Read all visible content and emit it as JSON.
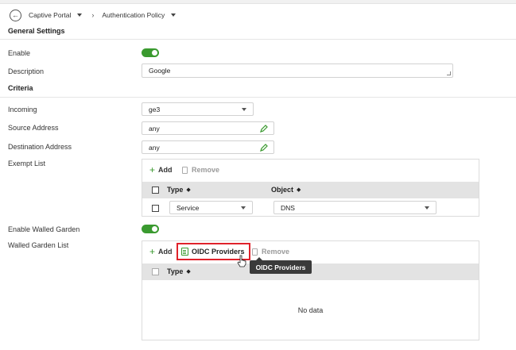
{
  "breadcrumb": {
    "items": [
      "Captive Portal",
      "Authentication Policy"
    ],
    "separator": "›"
  },
  "sections": {
    "general": "General Settings",
    "criteria": "Criteria"
  },
  "general": {
    "enable_label": "Enable",
    "enable_on": true,
    "description_label": "Description",
    "description_value": "Google"
  },
  "criteria": {
    "incoming_label": "Incoming",
    "incoming_value": "ge3",
    "source_label": "Source Address",
    "source_value": "any",
    "destination_label": "Destination Address",
    "destination_value": "any",
    "exempt_label": "Exempt List",
    "walled_garden_enable_label": "Enable Walled Garden",
    "walled_garden_enable_on": true,
    "walled_garden_list_label": "Walled Garden List"
  },
  "exempt_list": {
    "add_label": "Add",
    "remove_label": "Remove",
    "columns": [
      "Type",
      "Object"
    ],
    "rows": [
      {
        "type": "Service",
        "object": "DNS"
      }
    ]
  },
  "walled_garden": {
    "add_label": "Add",
    "oidc_label": "OIDC Providers",
    "remove_label": "Remove",
    "columns": [
      "Type"
    ],
    "empty_text": "No data",
    "tooltip": "OIDC Providers"
  },
  "colors": {
    "accent_green": "#3a9a2f",
    "highlight_red": "#e0222b",
    "tooltip_bg": "#3a3a3a"
  }
}
